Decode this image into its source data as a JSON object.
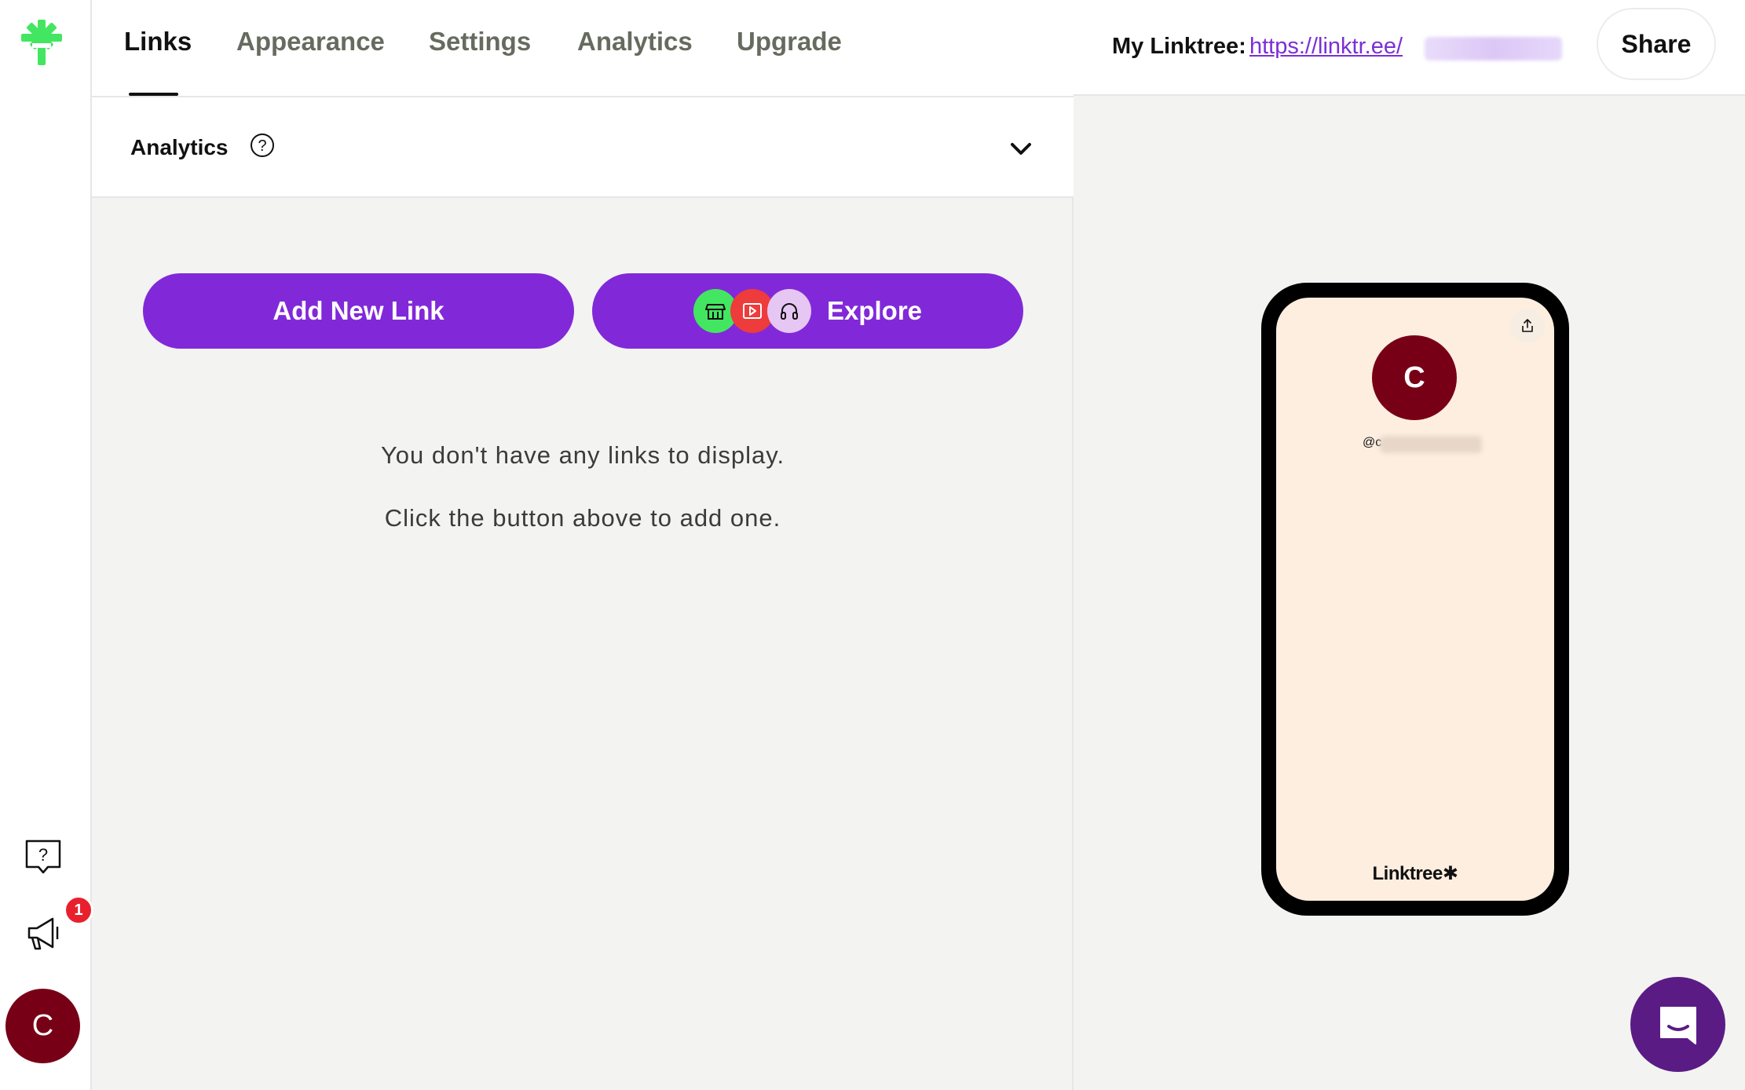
{
  "colors": {
    "accent": "#8129d9",
    "logo_green": "#43e660",
    "avatar": "#780016",
    "phone_background": "#fdeee0",
    "badge_red": "#e8202e",
    "chat_purple": "#5a1c84",
    "link_purple": "#7a2fd6"
  },
  "rail": {
    "logo_icon": "linktree-asterisk-icon",
    "help_icon": "help-chat-icon",
    "announce_icon": "megaphone-icon",
    "notification_count": "1",
    "avatar_initial": "C"
  },
  "tabs": [
    {
      "label": "Links",
      "active": true
    },
    {
      "label": "Appearance",
      "active": false
    },
    {
      "label": "Settings",
      "active": false
    },
    {
      "label": "Analytics",
      "active": false
    },
    {
      "label": "Upgrade",
      "active": false
    }
  ],
  "analytics": {
    "title": "Analytics",
    "help_icon": "question-circle-icon",
    "toggle_icon": "chevron-down-icon"
  },
  "actions": {
    "add_link_label": "Add New Link",
    "explore_label": "Explore",
    "explore_icons": [
      "store-icon",
      "video-play-icon",
      "headphones-icon"
    ]
  },
  "empty_state": {
    "line1": "You don't have any links to display.",
    "line2": "Click the button above to add one."
  },
  "preview": {
    "my_linktree_label": "My Linktree:",
    "url": "https://linktr.ee/",
    "share_label": "Share",
    "phone": {
      "avatar_initial": "C",
      "handle": "@c",
      "brand": "Linktree",
      "share_icon": "share-upload-icon"
    }
  },
  "support": {
    "chat_icon": "chat-bubble-icon"
  }
}
